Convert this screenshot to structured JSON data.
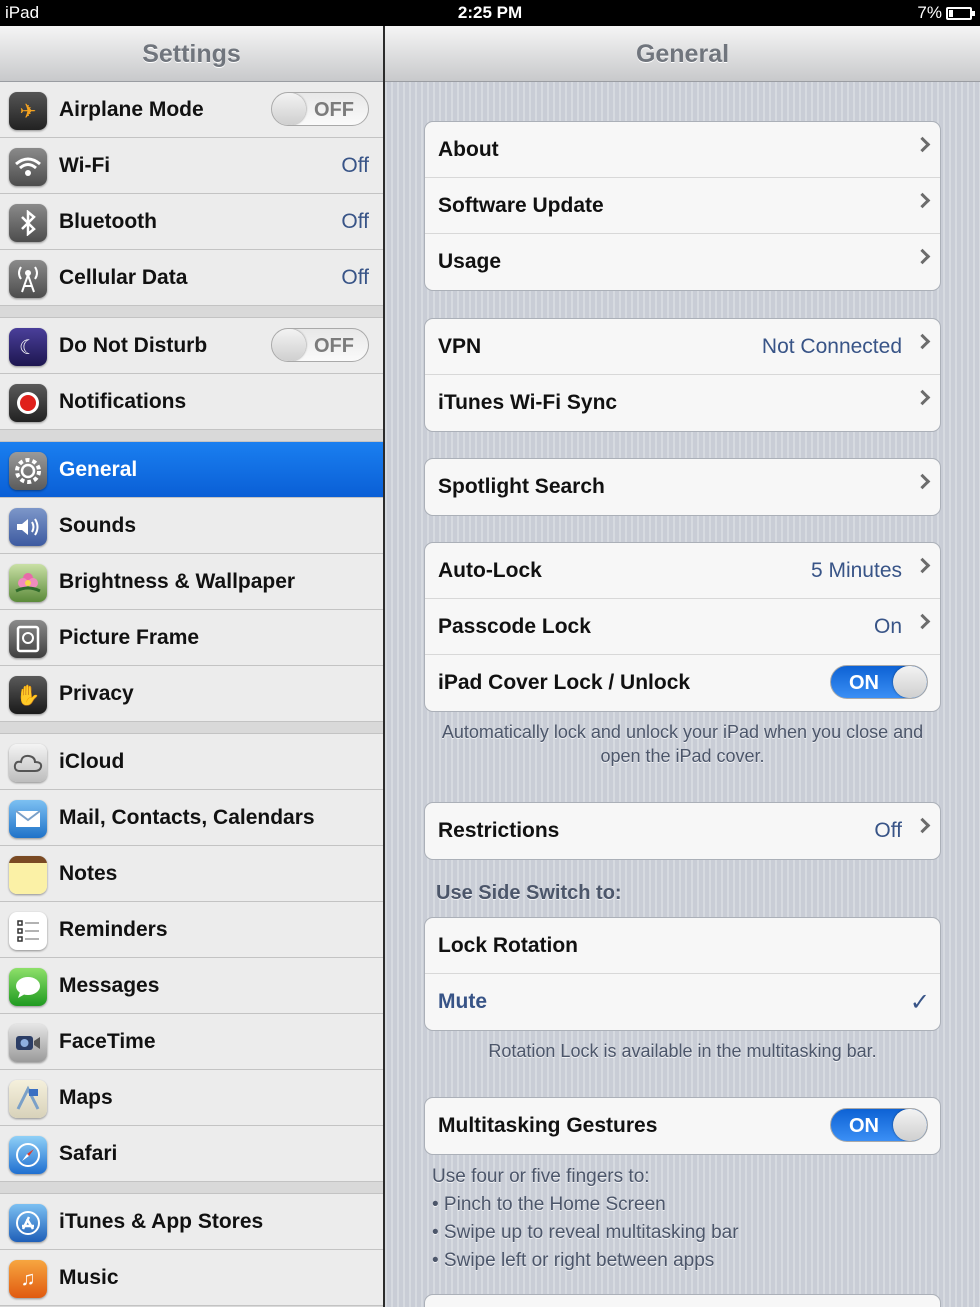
{
  "status": {
    "carrier": "iPad",
    "time": "2:25 PM",
    "battery": "7%"
  },
  "master": {
    "title": "Settings",
    "groups": [
      [
        {
          "label": "Airplane Mode",
          "icon": "airplane-icon",
          "toggle": "OFF"
        },
        {
          "label": "Wi-Fi",
          "icon": "wifi-icon",
          "value": "Off"
        },
        {
          "label": "Bluetooth",
          "icon": "bluetooth-icon",
          "value": "Off"
        },
        {
          "label": "Cellular Data",
          "icon": "antenna-icon",
          "value": "Off"
        }
      ],
      [
        {
          "label": "Do Not Disturb",
          "icon": "moon-icon",
          "toggle": "OFF"
        },
        {
          "label": "Notifications",
          "icon": "notifications-icon"
        }
      ],
      [
        {
          "label": "General",
          "icon": "gear-icon",
          "selected": true
        },
        {
          "label": "Sounds",
          "icon": "speaker-icon"
        },
        {
          "label": "Brightness & Wallpaper",
          "icon": "flower-icon"
        },
        {
          "label": "Picture Frame",
          "icon": "picture-frame-icon"
        },
        {
          "label": "Privacy",
          "icon": "hand-icon"
        }
      ],
      [
        {
          "label": "iCloud",
          "icon": "cloud-icon"
        },
        {
          "label": "Mail, Contacts, Calendars",
          "icon": "mail-icon"
        },
        {
          "label": "Notes",
          "icon": "notes-icon"
        },
        {
          "label": "Reminders",
          "icon": "reminders-icon"
        },
        {
          "label": "Messages",
          "icon": "messages-icon"
        },
        {
          "label": "FaceTime",
          "icon": "facetime-icon"
        },
        {
          "label": "Maps",
          "icon": "maps-icon"
        },
        {
          "label": "Safari",
          "icon": "compass-icon"
        }
      ],
      [
        {
          "label": "iTunes & App Stores",
          "icon": "app-store-icon"
        },
        {
          "label": "Music",
          "icon": "music-icon"
        }
      ]
    ]
  },
  "detail": {
    "title": "General",
    "groups": {
      "g1": [
        {
          "label": "About"
        },
        {
          "label": "Software Update"
        },
        {
          "label": "Usage"
        }
      ],
      "g2": [
        {
          "label": "VPN",
          "value": "Not Connected"
        },
        {
          "label": "iTunes Wi-Fi Sync"
        }
      ],
      "g3": [
        {
          "label": "Spotlight Search"
        }
      ],
      "g4": [
        {
          "label": "Auto-Lock",
          "value": "5 Minutes"
        },
        {
          "label": "Passcode Lock",
          "value": "On"
        },
        {
          "label": "iPad Cover Lock / Unlock",
          "toggle": "ON"
        }
      ],
      "g4_footer": "Automatically lock and unlock your iPad when you close and open the iPad cover.",
      "g5": [
        {
          "label": "Restrictions",
          "value": "Off"
        }
      ],
      "side_switch_header": "Use Side Switch to:",
      "g6": [
        {
          "label": "Lock Rotation"
        },
        {
          "label": "Mute",
          "checked": true
        }
      ],
      "g6_footer": "Rotation Lock is available in the multitasking bar.",
      "g7": [
        {
          "label": "Multitasking Gestures",
          "toggle": "ON"
        }
      ],
      "g7_footer": [
        "Use four or five fingers to:",
        "• Pinch to the Home Screen",
        "• Swipe up to reveal multitasking bar",
        "• Swipe left or right between apps"
      ]
    }
  },
  "colors": {
    "selection": "#0f6fe3",
    "value_text": "#385487",
    "toggle_on": "#1a73e8"
  }
}
